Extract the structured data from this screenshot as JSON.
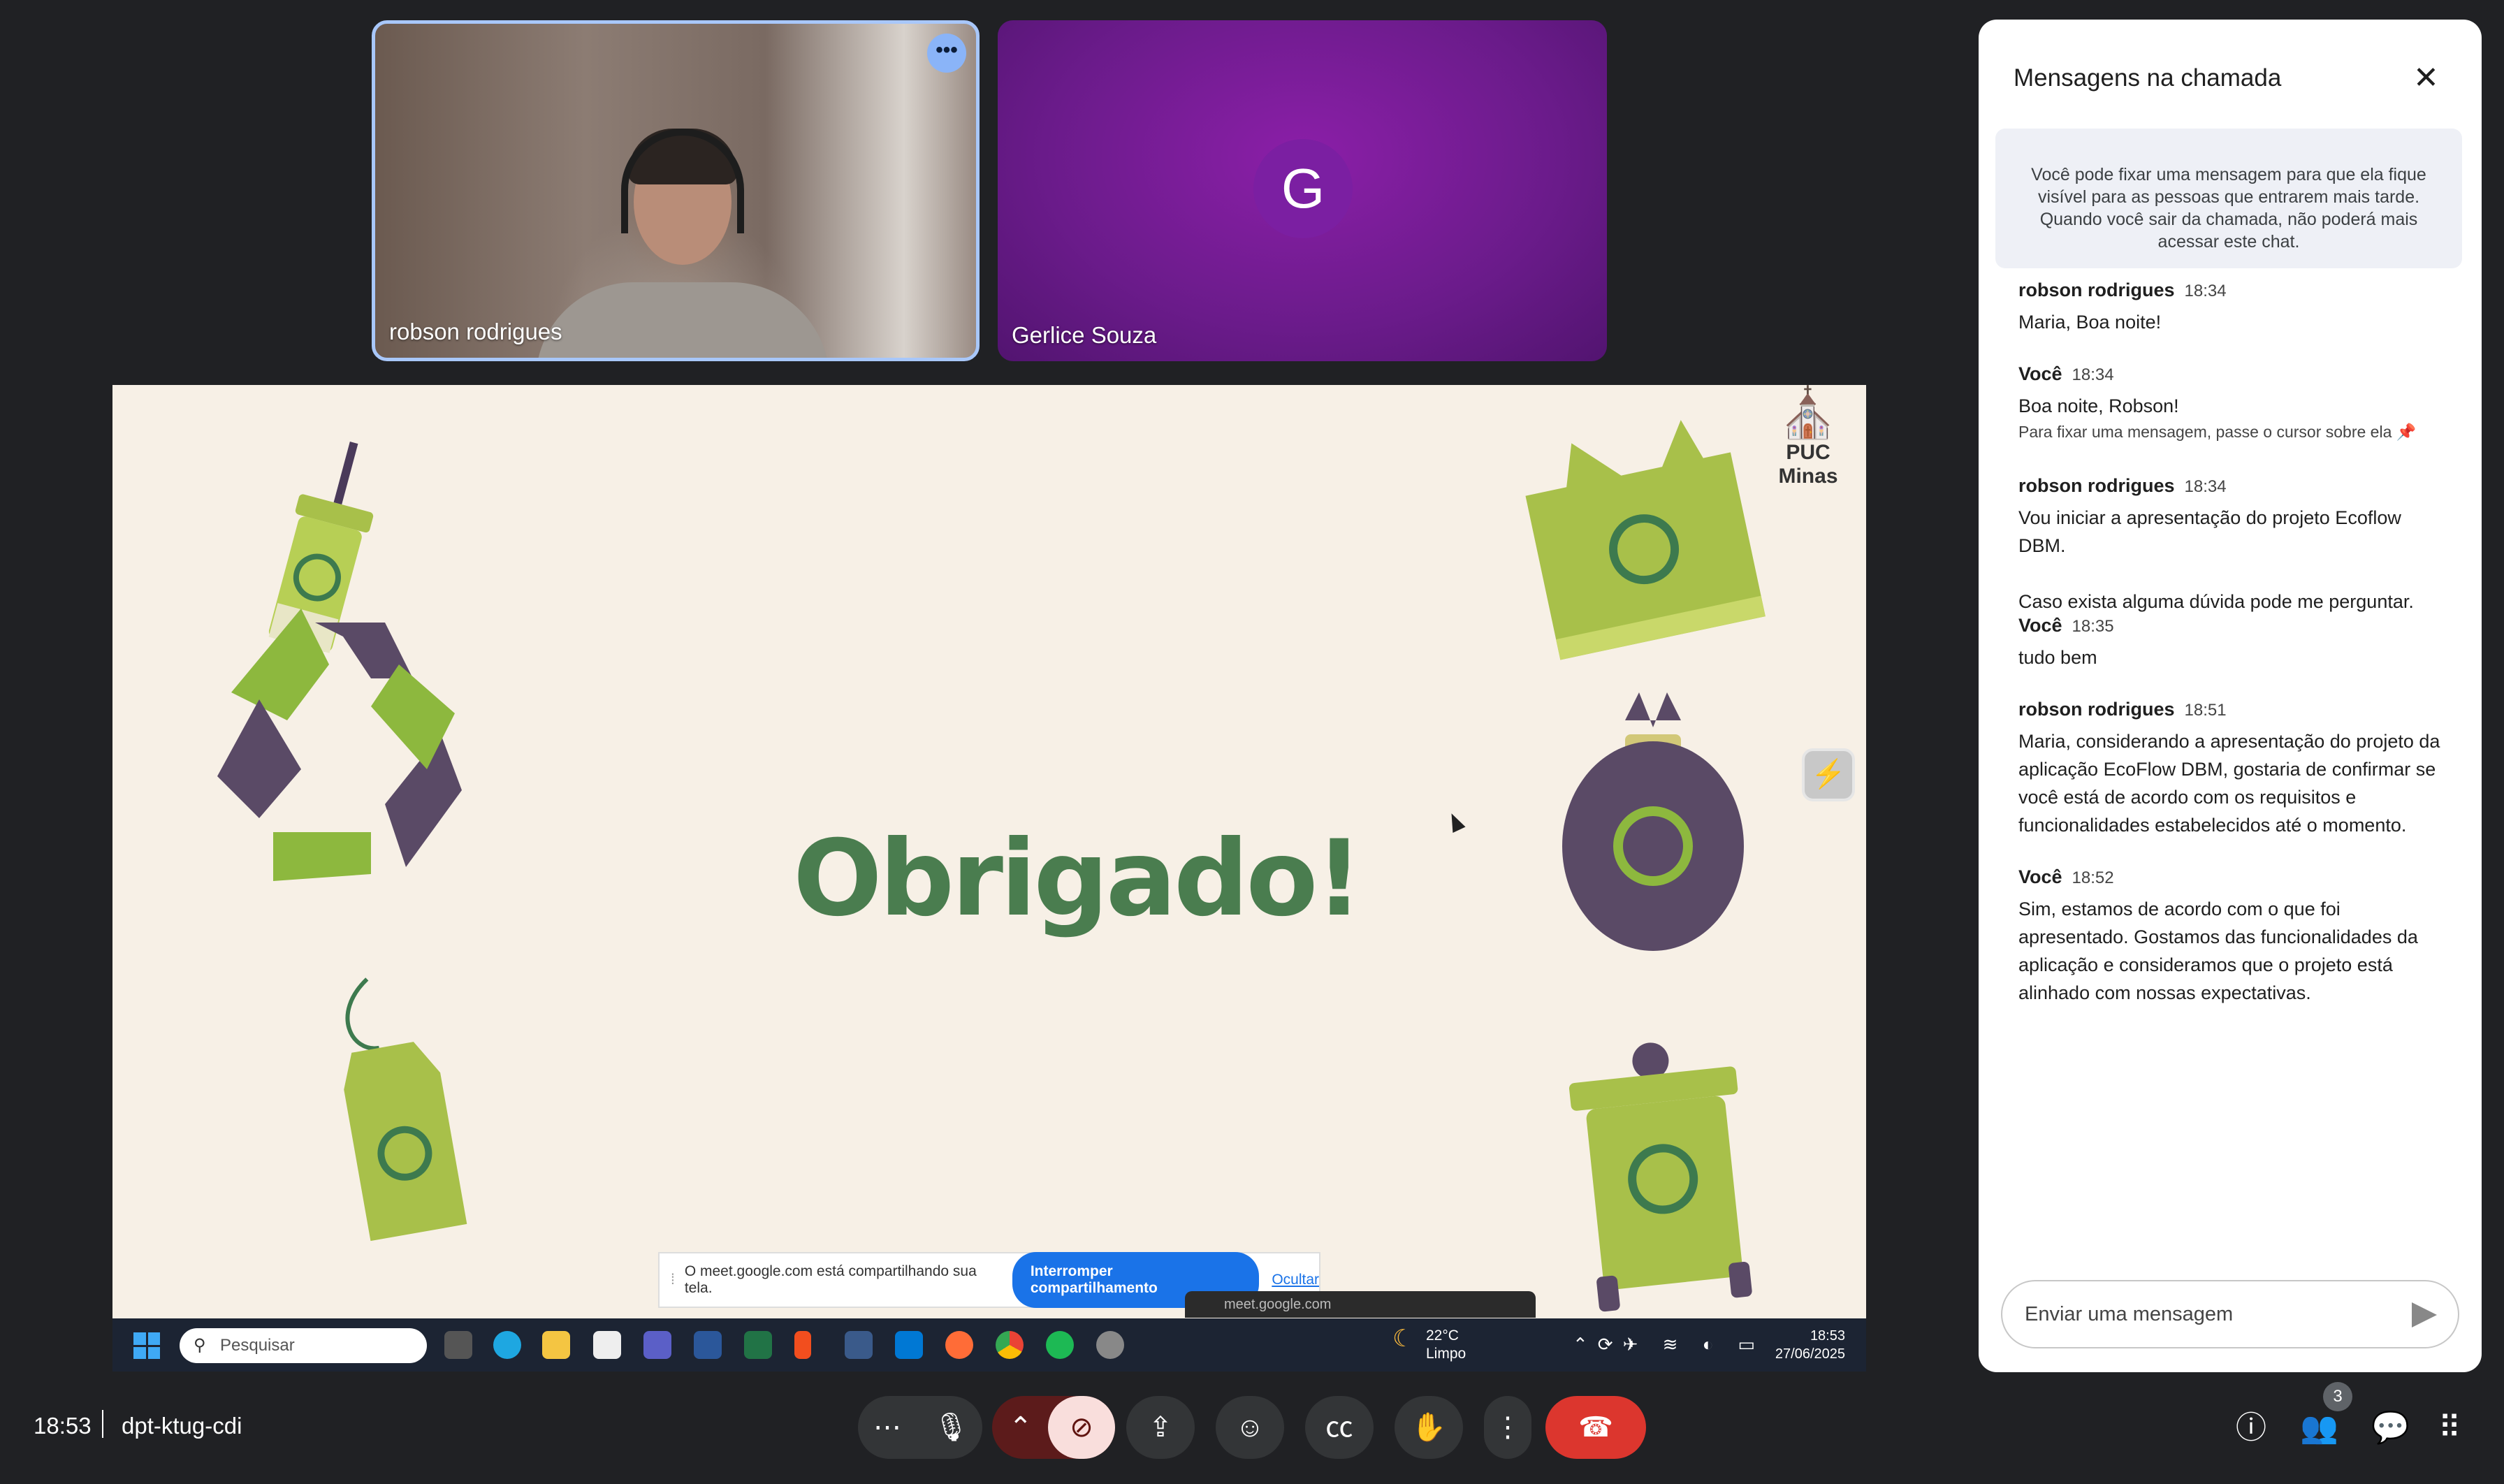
{
  "tiles": {
    "robson": {
      "name": "robson rodrigues"
    },
    "gerlice": {
      "name": "Gerlice Souza",
      "initial": "G"
    }
  },
  "slide": {
    "title": "Obrigado!",
    "logo_text": "PUC Minas",
    "background": "#f7f0e6",
    "title_color": "#4a7d4f"
  },
  "share_bar": {
    "message": "O meet.google.com está compartilhando sua tela.",
    "stop_label": "Interromper compartilhamento",
    "hide_label": "Ocultar",
    "url_chip": "meet.google.com"
  },
  "taskbar": {
    "search_placeholder": "Pesquisar",
    "weather_temp": "22°C",
    "weather_desc": "Limpo",
    "clock_time": "18:53",
    "clock_date": "27/06/2025"
  },
  "chat": {
    "title": "Mensagens na chamada",
    "notice": "Você pode fixar uma mensagem para que ela fique visível para as pessoas que entrarem mais tarde. Quando você sair da chamada, não poderá mais acessar este chat.",
    "messages": [
      {
        "sender": "robson rodrigues",
        "time": "18:34",
        "text": "Maria, Boa noite!"
      },
      {
        "sender": "Você",
        "time": "18:34",
        "text": "Boa noite, Robson!",
        "hint": "Para fixar uma mensagem, passe o cursor sobre ela"
      },
      {
        "sender": "robson rodrigues",
        "time": "18:34",
        "text": "Vou iniciar a apresentação do projeto Ecoflow DBM.",
        "text2": "Caso exista alguma dúvida pode me perguntar."
      },
      {
        "sender": "Você",
        "time": "18:35",
        "text": "tudo bem"
      },
      {
        "sender": "robson rodrigues",
        "time": "18:51",
        "text": "Maria, considerando a apresentação do projeto da aplicação EcoFlow DBM, gostaria de confirmar se você está de acordo com os requisitos e funcionalidades estabelecidos até o momento."
      },
      {
        "sender": "Você",
        "time": "18:52",
        "text": "Sim, estamos de acordo com o que foi apresentado. Gostamos das funcionalidades da aplicação e consideramos que o projeto está alinhado com nossas expectativas."
      }
    ],
    "input_placeholder": "Enviar uma mensagem"
  },
  "bottom_bar": {
    "time": "18:53",
    "meeting_code": "dpt-ktug-cdi",
    "people_count": "3",
    "end_call_color": "#dc362e"
  },
  "icons": {
    "more_options": "more-horizontal-icon",
    "mic": "mic-icon",
    "camera_off": "camera-off-icon",
    "present": "present-screen-icon",
    "emoji": "emoji-icon",
    "captions": "captions-icon",
    "raise_hand": "raise-hand-icon",
    "more_vert": "more-vertical-icon",
    "end_call": "end-call-icon",
    "info": "info-icon",
    "people": "people-icon",
    "chat": "chat-icon",
    "activities": "apps-grid-icon"
  }
}
